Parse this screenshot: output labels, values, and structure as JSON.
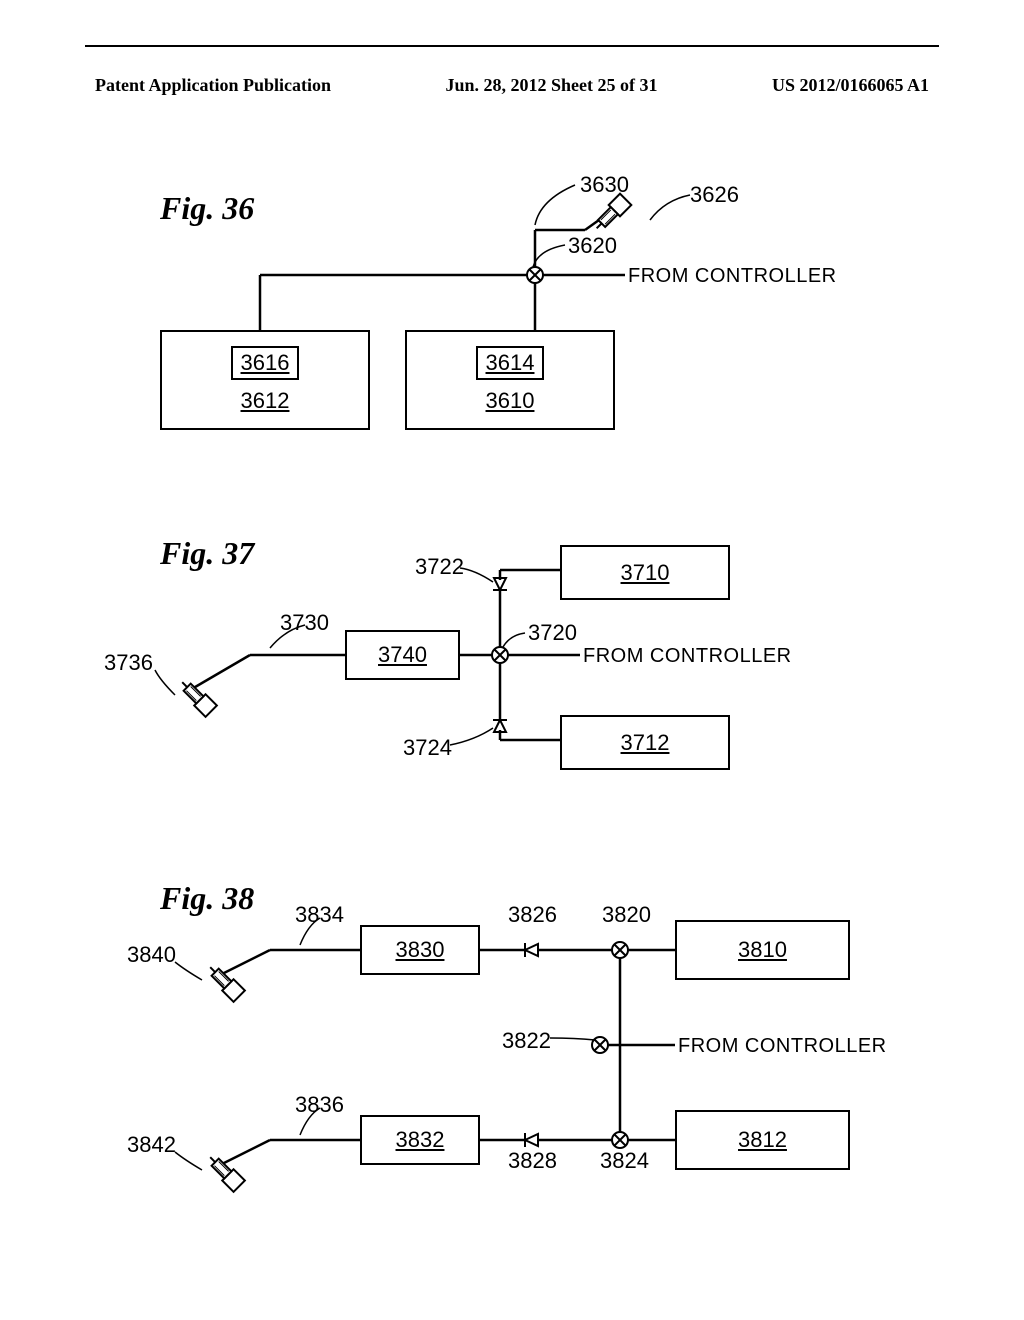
{
  "header": {
    "left": "Patent Application Publication",
    "center": "Jun. 28, 2012  Sheet 25 of 31",
    "right": "US 2012/0166065 A1"
  },
  "fig36": {
    "title": "Fig. 36",
    "controller": "FROM CONTROLLER",
    "refs": {
      "3610": "3610",
      "3612": "3612",
      "3614": "3614",
      "3616": "3616",
      "3620": "3620",
      "3626": "3626",
      "3630": "3630"
    }
  },
  "fig37": {
    "title": "Fig. 37",
    "controller": "FROM CONTROLLER",
    "refs": {
      "3710": "3710",
      "3712": "3712",
      "3720": "3720",
      "3722": "3722",
      "3724": "3724",
      "3730": "3730",
      "3736": "3736",
      "3740": "3740"
    }
  },
  "fig38": {
    "title": "Fig. 38",
    "controller": "FROM CONTROLLER",
    "refs": {
      "3810": "3810",
      "3812": "3812",
      "3820": "3820",
      "3822": "3822",
      "3824": "3824",
      "3826": "3826",
      "3828": "3828",
      "3830": "3830",
      "3832": "3832",
      "3834": "3834",
      "3836": "3836",
      "3840": "3840",
      "3842": "3842"
    }
  }
}
